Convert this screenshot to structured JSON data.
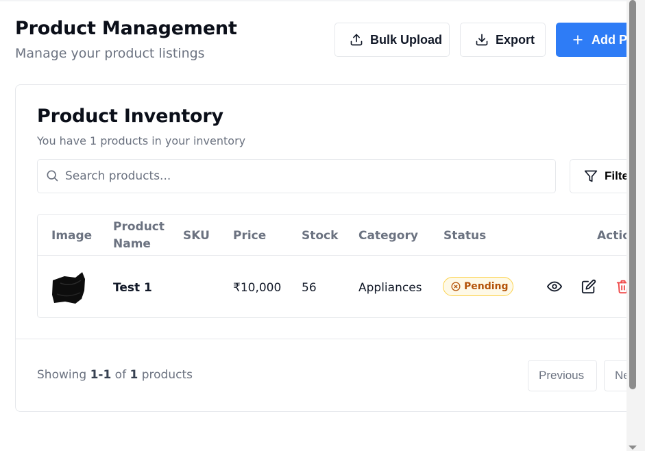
{
  "header": {
    "title": "Product Management",
    "subtitle": "Manage your product listings",
    "bulk_upload_label": "Bulk Upload",
    "export_label": "Export",
    "add_label": "Add Pr"
  },
  "inventory": {
    "title": "Product Inventory",
    "subtitle": "You have 1 products in your inventory",
    "search_placeholder": "Search products...",
    "filter_label": "Filte",
    "columns": [
      "Image",
      "Product",
      "Name",
      "SKU",
      "Price",
      "Stock",
      "Category",
      "Status",
      "Actio"
    ],
    "rows": [
      {
        "name": "Test 1",
        "sku": "",
        "price": "₹10,000",
        "stock": "56",
        "category": "Appliances",
        "status": "Pending"
      }
    ]
  },
  "pagination": {
    "prefix": "Showing ",
    "range": "1-1",
    "of": " of ",
    "total": "1",
    "suffix": " products",
    "previous_label": "Previous",
    "next_label": "Ne"
  },
  "colors": {
    "primary": "#2e7cf6",
    "pending_bg": "#fef9e7",
    "pending_text": "#b45309",
    "delete": "#ef4444"
  }
}
